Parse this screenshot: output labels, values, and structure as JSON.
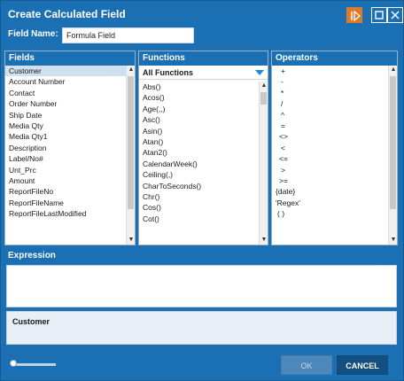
{
  "window": {
    "title": "Create Calculated Field"
  },
  "field_name": {
    "label": "Field Name:",
    "value": "Formula Field"
  },
  "fields_panel": {
    "header": "Fields",
    "items": [
      "Customer",
      "Account Number",
      "Contact",
      "Order Number",
      "Ship Date",
      "Media Qty",
      "Media Qty1",
      "Description",
      "Label/No#",
      "Unt_Prc",
      "Amount",
      "ReportFileNo",
      "ReportFileName",
      "ReportFileLastModified"
    ],
    "selected": "Customer"
  },
  "functions_panel": {
    "header": "Functions",
    "category_selected": "All Functions",
    "items": [
      "Abs()",
      "Acos()",
      "Age(,,)",
      "Asc()",
      "Asin()",
      "Atan()",
      "Atan2()",
      "CalendarWeek()",
      "Ceiling(,)",
      "CharToSeconds()",
      "Chr()",
      "Cos()",
      "Cot()"
    ]
  },
  "operators_panel": {
    "header": "Operators",
    "items": [
      "+",
      "-",
      "*",
      "/",
      "^",
      "=",
      "<>",
      "<",
      "<=",
      ">",
      ">=",
      "{date}",
      "'Regex'",
      "( )"
    ]
  },
  "expression": {
    "header": "Expression",
    "info": "Customer"
  },
  "buttons": {
    "ok": "OK",
    "cancel": "CANCEL"
  },
  "colors": {
    "accent": "#1b6fb3",
    "run_button": "#e07a2b"
  }
}
